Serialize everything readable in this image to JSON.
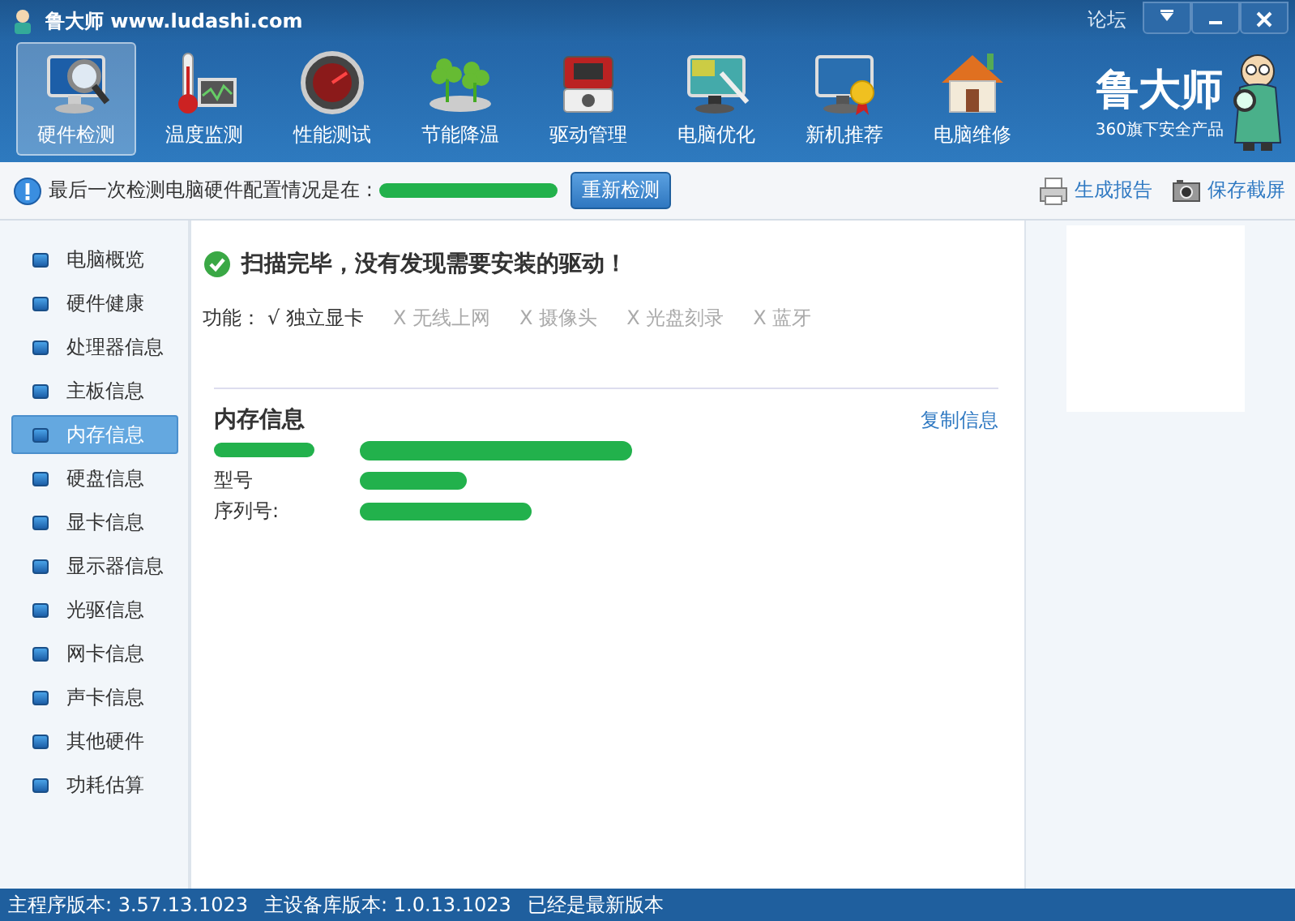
{
  "window": {
    "title": "鲁大师 www.ludashi.com",
    "forum_link": "论坛"
  },
  "toolbar": [
    {
      "label": "硬件检测",
      "selected": true
    },
    {
      "label": "温度监测",
      "selected": false
    },
    {
      "label": "性能测试",
      "selected": false
    },
    {
      "label": "节能降温",
      "selected": false
    },
    {
      "label": "驱动管理",
      "selected": false
    },
    {
      "label": "电脑优化",
      "selected": false
    },
    {
      "label": "新机推荐",
      "selected": false
    },
    {
      "label": "电脑维修",
      "selected": false
    }
  ],
  "brand": {
    "logo": "鲁大师",
    "tagline": "360旗下安全产品"
  },
  "info_bar": {
    "text": "最后一次检测电脑硬件配置情况是在 :",
    "redacted": true,
    "button": "重新检测",
    "actions": [
      {
        "label": "生成报告"
      },
      {
        "label": "保存截屏"
      }
    ]
  },
  "sidebar": {
    "items": [
      {
        "label": "电脑概览",
        "selected": false
      },
      {
        "label": "硬件健康",
        "selected": false
      },
      {
        "label": "处理器信息",
        "selected": false
      },
      {
        "label": "主板信息",
        "selected": false
      },
      {
        "label": "内存信息",
        "selected": true
      },
      {
        "label": "硬盘信息",
        "selected": false
      },
      {
        "label": "显卡信息",
        "selected": false
      },
      {
        "label": "显示器信息",
        "selected": false
      },
      {
        "label": "光驱信息",
        "selected": false
      },
      {
        "label": "网卡信息",
        "selected": false
      },
      {
        "label": "声卡信息",
        "selected": false
      },
      {
        "label": "其他硬件",
        "selected": false
      },
      {
        "label": "功耗估算",
        "selected": false
      }
    ]
  },
  "content": {
    "status": "扫描完毕，没有发现需要安装的驱动！",
    "features_label": "功能：",
    "features": [
      {
        "mark": "√",
        "label": "独立显卡",
        "available": true
      },
      {
        "mark": "X",
        "label": "无线上网",
        "available": false
      },
      {
        "mark": "X",
        "label": "摄像头",
        "available": false
      },
      {
        "mark": "X",
        "label": "光盘刻录",
        "available": false
      },
      {
        "mark": "X",
        "label": "蓝牙",
        "available": false
      }
    ],
    "section_title": "内存信息",
    "copy_link": "复制信息",
    "rows": [
      {
        "redacted": true
      },
      {
        "label": "型号",
        "redacted": true
      },
      {
        "label": "序列号:",
        "redacted": true
      }
    ]
  },
  "status_bar": [
    "主程序版本: 3.57.13.1023",
    "主设备库版本: 1.0.13.1023",
    "已经是最新版本"
  ]
}
